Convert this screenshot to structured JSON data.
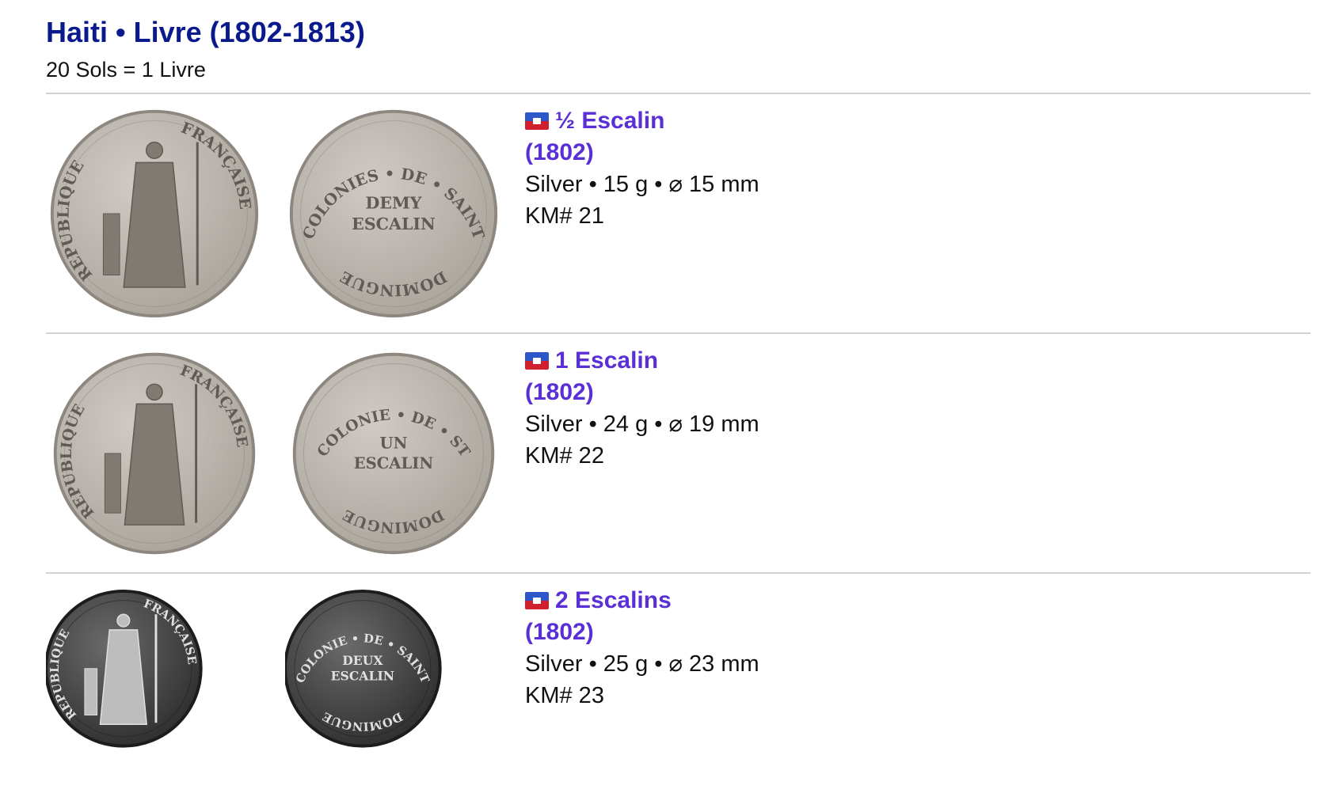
{
  "page": {
    "title": "Haiti • Livre (1802-1813)",
    "subtitle": "20 Sols = 1 Livre"
  },
  "colors": {
    "title": "#0a1a8c",
    "link": "#5b2fd6",
    "divider": "#d3d3d3",
    "flag_blue": "#2d56c9",
    "flag_red": "#d0202e"
  },
  "coins": [
    {
      "flag_icon": "haiti-flag-icon",
      "name": "½ Escalin",
      "year": "(1802)",
      "specs": "Silver • 15 g • ⌀ 15 mm",
      "km": "KM# 21",
      "obverse": {
        "legend_left": "REPUBLIQUE",
        "legend_right": "FRANÇAISE",
        "tone": "light"
      },
      "reverse": {
        "legend_top": "COLONIES • DE • SAINT",
        "legend_bottom": "DOMINGUE",
        "center_lines": [
          "DEMY",
          "ESCALIN"
        ],
        "tone": "light"
      }
    },
    {
      "flag_icon": "haiti-flag-icon",
      "name": "1 Escalin",
      "year": "(1802)",
      "specs": "Silver • 24 g • ⌀ 19 mm",
      "km": "KM# 22",
      "obverse": {
        "legend_left": "REPUBLIQUE",
        "legend_right": "FRANÇAISE",
        "tone": "light"
      },
      "reverse": {
        "legend_top": "COLONIE • DE • ST",
        "legend_bottom": "DOMINGUE",
        "center_lines": [
          "UN",
          "ESCALIN"
        ],
        "tone": "light"
      }
    },
    {
      "flag_icon": "haiti-flag-icon",
      "name": "2 Escalins",
      "year": "(1802)",
      "specs": "Silver • 25 g • ⌀ 23 mm",
      "km": "KM# 23",
      "obverse": {
        "legend_left": "REPUBLIQUE",
        "legend_right": "FRANÇAISE",
        "tone": "dark"
      },
      "reverse": {
        "legend_top": "COLONIE • DE • SAINT",
        "legend_bottom": "DOMINGUE",
        "center_lines": [
          "DEUX",
          "ESCALIN"
        ],
        "tone": "dark"
      }
    }
  ]
}
